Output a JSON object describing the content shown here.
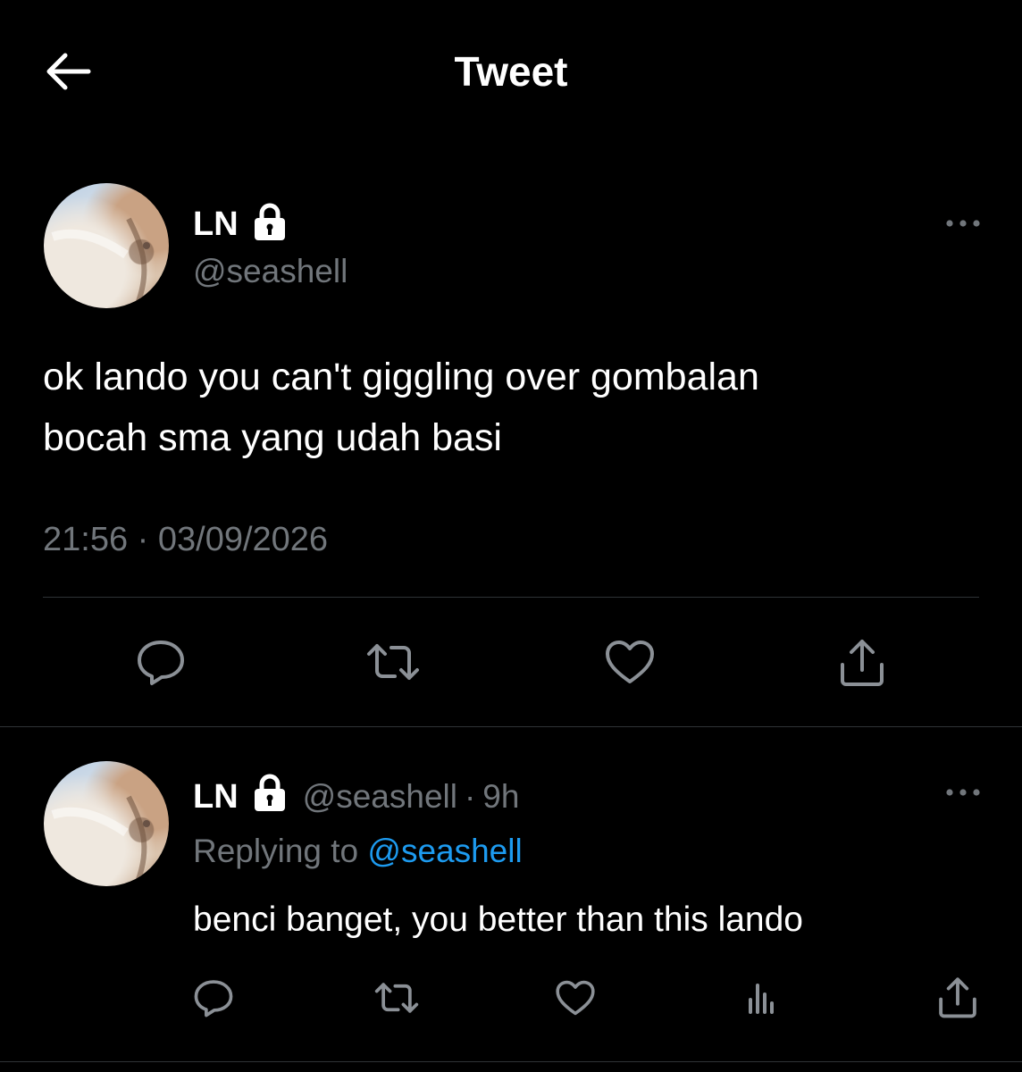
{
  "header": {
    "title": "Tweet"
  },
  "main_tweet": {
    "display_name": "LN",
    "handle": "@seashell",
    "text": "ok lando you can't giggling over gombalan\nbocah sma yang udah basi",
    "time": "21:56",
    "separator": "·",
    "date": "03/09/2026"
  },
  "reply": {
    "display_name": "LN",
    "handle": "@seashell",
    "separator": "·",
    "age": "9h",
    "replying_prefix": "Replying to",
    "replying_handle": "@seashell",
    "text": "benci banget, you better than this lando"
  },
  "colors": {
    "background": "#000000",
    "text_primary": "#ffffff",
    "text_secondary": "#71767b",
    "link": "#1d9bf0",
    "divider": "#2f3336"
  },
  "icons": {
    "back": "arrow-left-icon",
    "lock": "lock-icon",
    "more": "ellipsis-icon",
    "reply": "speech-bubble-icon",
    "retweet": "retweet-icon",
    "like": "heart-icon",
    "share": "share-icon",
    "views": "bar-chart-icon"
  }
}
